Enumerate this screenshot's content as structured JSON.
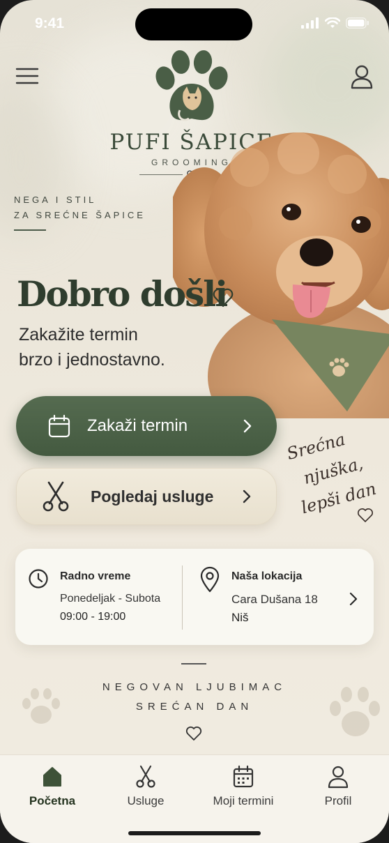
{
  "status_bar": {
    "time": "9:41"
  },
  "brand": {
    "name": "PUFI ŠAPICE",
    "sub": "GROOMING"
  },
  "tagline": {
    "line1": "NEGA I STIL",
    "line2": "ZA SREĆNE ŠAPICE"
  },
  "hero": {
    "title": "Dobro došli",
    "subtitle_line1": "Zakažite termin",
    "subtitle_line2": "brzo i jednostavno."
  },
  "actions": {
    "primary_label": "Zakaži termin",
    "secondary_label": "Pogledaj usluge"
  },
  "script_note": {
    "line1": "Srećna",
    "line2": "njuška,",
    "line3": "lepši dan"
  },
  "info": {
    "hours_title": "Radno vreme",
    "hours_days": "Ponedeljak - Subota",
    "hours_time": "09:00 - 19:00",
    "location_title": "Naša lokacija",
    "location_street": "Cara Dušana 18",
    "location_city": "Niš"
  },
  "motto": {
    "line1": "NEGOVAN LJUBIMAC",
    "line2": "SREĆAN DAN"
  },
  "tabs": [
    {
      "label": "Početna",
      "icon": "home-icon",
      "active": true
    },
    {
      "label": "Usluge",
      "icon": "scissors-icon",
      "active": false
    },
    {
      "label": "Moji termini",
      "icon": "calendar-icon",
      "active": false
    },
    {
      "label": "Profil",
      "icon": "user-icon",
      "active": false
    }
  ],
  "colors": {
    "accent": "#4d6348",
    "background": "#ece7db",
    "card": "#faf8f3"
  }
}
